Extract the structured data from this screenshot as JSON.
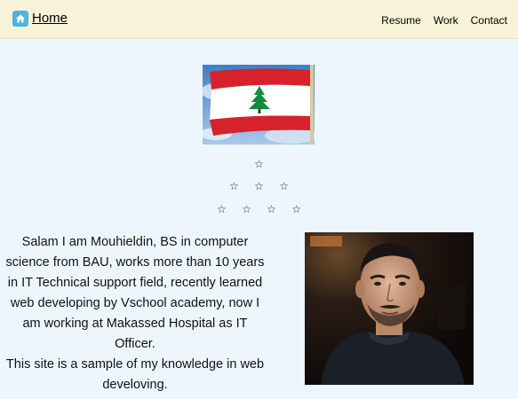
{
  "nav": {
    "home_label": "Home",
    "home_icon": "home-icon",
    "links": [
      "Resume",
      "Work",
      "Contact"
    ]
  },
  "stars": {
    "glyph": "☆",
    "rows": [
      1,
      3,
      4
    ]
  },
  "bio": {
    "paragraph1": "Salam I am Mouhieldin, BS in computer science from BAU, works more than 10 years in IT Technical support field, recently learned web developing by Vschool academy, now I am working at Makassed Hospital as IT Officer.",
    "paragraph2": "This site is a sample of my knowledge in web develoving."
  },
  "colors": {
    "navbar_bg": "#f7f3d8",
    "page_bg": "#eef6fd",
    "home_icon_bg": "#4fb3df",
    "flag_red": "#d7212b",
    "cedar_green": "#118c3a"
  }
}
